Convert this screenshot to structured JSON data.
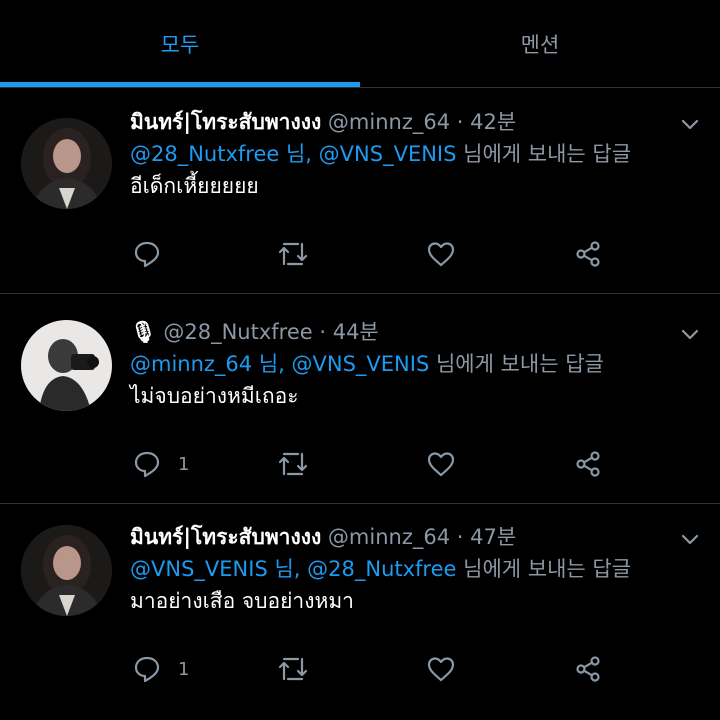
{
  "tabs": [
    {
      "label": "모두"
    },
    {
      "label": "멘션"
    }
  ],
  "tweets": [
    {
      "display_name": "มินทร์|โทระสับพางงง",
      "handle": "@minnz_64",
      "separator": " · ",
      "time": "42분",
      "mention1": "@28_Nutxfree",
      "mention_sep": " 님, ",
      "mention2": "@VNS_VENIS",
      "reply_suffix": " 님에게 보내는 답글",
      "text": "อีเด็กเหี้ยยยยย",
      "reply_count": ""
    },
    {
      "display_name": "🎙",
      "handle": "@28_Nutxfree",
      "separator": " · ",
      "time": "44분",
      "mention1": "@minnz_64",
      "mention_sep": " 님, ",
      "mention2": "@VNS_VENIS",
      "reply_suffix": " 님에게 보내는 답글",
      "text": "ไม่จบอย่างหมีเถอะ",
      "reply_count": "1"
    },
    {
      "display_name": "มินทร์|โทระสับพางงง",
      "handle": "@minnz_64",
      "separator": " · ",
      "time": "47분",
      "mention1": "@VNS_VENIS",
      "mention_sep": " 님, ",
      "mention2": "@28_Nutxfree",
      "reply_suffix": " 님에게 보내는 답글",
      "text": "มาอย่างเสือ จบอย่างหมา",
      "reply_count": "1"
    }
  ],
  "colors": {
    "accent": "#1d9bf0",
    "muted": "#8b98a5",
    "background": "#000000",
    "divider": "#2f3336"
  },
  "icons": [
    "reply-icon",
    "retweet-icon",
    "like-icon",
    "share-icon",
    "chevron-down-icon"
  ]
}
